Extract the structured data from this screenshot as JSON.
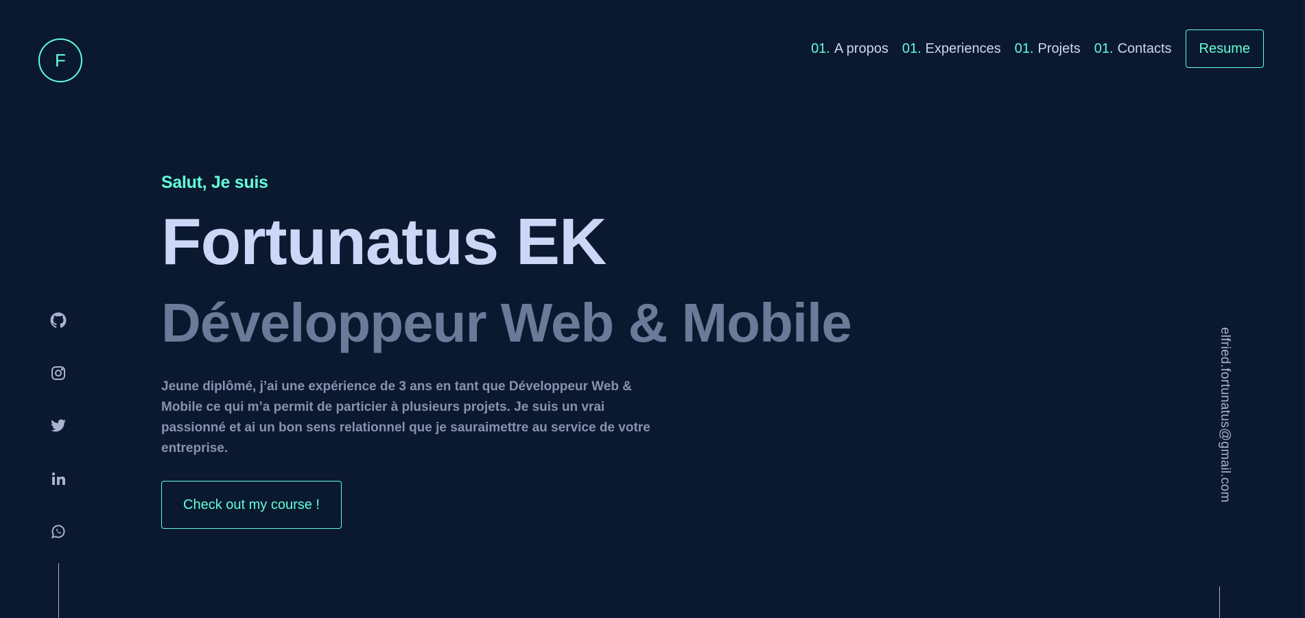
{
  "logo": {
    "letter": "F"
  },
  "nav": {
    "items": [
      {
        "num": "01.",
        "label": "A propos"
      },
      {
        "num": "01.",
        "label": "Experiences"
      },
      {
        "num": "01.",
        "label": "Projets"
      },
      {
        "num": "01.",
        "label": "Contacts"
      }
    ],
    "resume_label": "Resume"
  },
  "hero": {
    "greeting": "Salut, Je suis",
    "name": "Fortunatus EK",
    "tagline": "Développeur Web & Mobile",
    "description": "Jeune diplômé, j’ai une expérience de 3 ans en tant que Développeur Web & Mobile ce qui m’a permit de particier à plusieurs projets. Je suis un vrai passionné et ai un bon sens relationnel que je sauraimettre au service de votre entreprise.",
    "cta_label": "Check out my course !"
  },
  "socials": [
    "github-icon",
    "instagram-icon",
    "twitter-icon",
    "linkedin-icon",
    "whatsapp-icon"
  ],
  "email": "elfried.fortunatus@gmail.com",
  "colors": {
    "background": "#0a192f",
    "accent": "#64ffda",
    "heading": "#ccd6f6",
    "subheading": "#6a7a98",
    "body_text": "#8892b0",
    "icon": "#a8b2d1"
  }
}
